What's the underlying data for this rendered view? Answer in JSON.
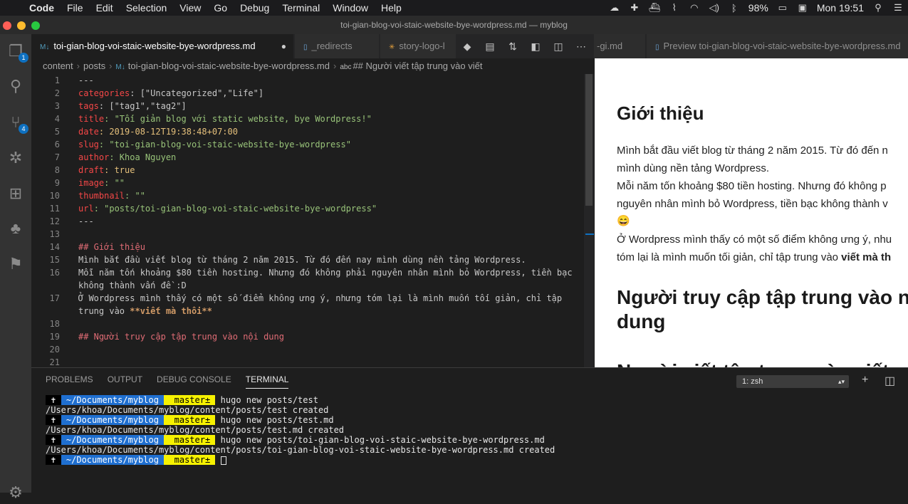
{
  "menubar": {
    "app_name": "Code",
    "items": [
      "File",
      "Edit",
      "Selection",
      "View",
      "Go",
      "Debug",
      "Terminal",
      "Window",
      "Help"
    ],
    "battery": "98%",
    "clock": "Mon 19:51"
  },
  "window": {
    "title": "toi-gian-blog-voi-staic-website-bye-wordpress.md — myblog"
  },
  "tabs": [
    {
      "label": "toi-gian-blog-voi-staic-website-bye-wordpress.md",
      "icon": "M↓"
    },
    {
      "label": "_redirects"
    },
    {
      "label": "story-logo-l"
    },
    {
      "label": "-gi.md"
    },
    {
      "label": "Preview toi-gian-blog-voi-staic-website-bye-wordpress.md"
    }
  ],
  "activity_badges": {
    "explorer": "1",
    "scm": "4"
  },
  "breadcrumb": {
    "parts": [
      "content",
      "posts"
    ],
    "file": "toi-gian-blog-voi-staic-website-bye-wordpress.md",
    "file_icon": "M↓",
    "symbol_icon": "abc",
    "symbol": "## Người viết tập trung vào viết"
  },
  "editor": {
    "lines": [
      {
        "n": "1",
        "text": "---"
      },
      {
        "n": "2",
        "key": "categories",
        "rest": ": [\"Uncategorized\",\"Life\"]"
      },
      {
        "n": "3",
        "key": "tags",
        "rest": ": [\"tag1\",\"tag2\"]"
      },
      {
        "n": "4",
        "key": "title",
        "rest": ": \"Tối giản blog với static website, bye Wordpress!\""
      },
      {
        "n": "5",
        "key": "date",
        "rest": ": 2019-08-12T19:38:48+07:00"
      },
      {
        "n": "6",
        "key": "slug",
        "rest": ": \"toi-gian-blog-voi-staic-website-bye-wordpress\""
      },
      {
        "n": "7",
        "key": "author",
        "rest": ": Khoa Nguyen"
      },
      {
        "n": "8",
        "key": "draft",
        "rest": ": true"
      },
      {
        "n": "9",
        "key": "image",
        "rest": ": \"\""
      },
      {
        "n": "10",
        "key": "thumbnail",
        "rest": ": \"\""
      },
      {
        "n": "11",
        "key": "url",
        "rest": ": \"posts/toi-gian-blog-voi-staic-website-bye-wordpress\""
      },
      {
        "n": "12",
        "text": "---"
      },
      {
        "n": "13",
        "text": ""
      },
      {
        "n": "14",
        "heading": "## Giới thiệu"
      },
      {
        "n": "15",
        "text": "Mình bắt đầu viết blog từ tháng 2 năm 2015. Từ đó đến nay mình dùng nền tảng Wordpress."
      },
      {
        "n": "16",
        "text": "Mỗi năm tốn khoảng $80 tiền hosting. Nhưng đó không phải nguyên nhân mình bỏ Wordpress, tiền bạc"
      },
      {
        "n": "",
        "text": "không thành vấn đề :D"
      },
      {
        "n": "17",
        "text": "Ở Wordpress mình thấy có một số điểm không ưng ý, nhưng tóm lại là mình muốn tối giản, chỉ tập"
      },
      {
        "n": "",
        "text": "trung vào ",
        "bold": "**viết mà thôi**"
      },
      {
        "n": "18",
        "text": ""
      },
      {
        "n": "19",
        "heading": "## Người truy cập tập trung vào nội dung"
      },
      {
        "n": "20",
        "text": ""
      },
      {
        "n": "21",
        "text": ""
      }
    ]
  },
  "preview": {
    "h1": "Giới thiệu",
    "p1": "Mình bắt đầu viết blog từ tháng 2 năm 2015. Từ đó đến n",
    "p2": "mình dùng nền tảng Wordpress.",
    "p3": "Mỗi năm tốn khoảng $80 tiền hosting. Nhưng đó không p",
    "p4": "nguyên nhân mình bỏ Wordpress, tiền bạc không thành v",
    "emoji": "😄",
    "p5": "Ở Wordpress mình thấy có một số điểm không ưng ý, nhu",
    "p6": "tóm lại là mình muốn tối giản, chỉ tập trung vào ",
    "p6_bold": "viết mà th",
    "h2_line1": "Người truy cập tập trung vào n",
    "h2_line2": "dung",
    "h3_partial": "Người viết tập trung vào viết"
  },
  "panel": {
    "tabs": [
      "PROBLEMS",
      "OUTPUT",
      "DEBUG CONSOLE",
      "TERMINAL"
    ],
    "active_tab": "TERMINAL",
    "terminal_select": "1: zsh",
    "prompt_dir": " ~/Documents/myblog ",
    "prompt_branch": "  master± ",
    "commands": [
      "hugo new posts/test",
      "hugo new posts/test.md",
      "hugo new posts/toi-gian-blog-voi-staic-website-bye-wordpress.md"
    ],
    "outputs": [
      "/Users/khoa/Documents/myblog/content/posts/test created",
      "/Users/khoa/Documents/myblog/content/posts/test.md created",
      "/Users/khoa/Documents/myblog/content/posts/toi-gian-blog-voi-staic-website-bye-wordpress.md created"
    ]
  }
}
